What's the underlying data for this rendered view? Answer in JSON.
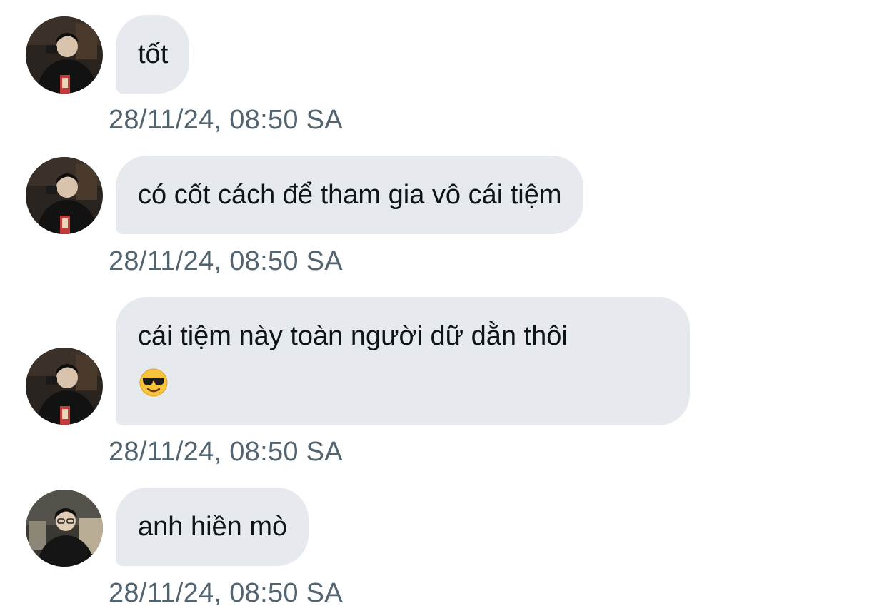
{
  "messages": [
    {
      "text": "tốt",
      "time": "28/11/24, 08:50 SA",
      "avatar": "avatar-photo-a"
    },
    {
      "text": "có cốt cách để tham gia vô cái tiệm",
      "time": "28/11/24, 08:50 SA",
      "avatar": "avatar-photo-a"
    },
    {
      "text": "cái tiệm này toàn người dữ dằn thôi",
      "emoji": "smiling-face-with-sunglasses",
      "time": "28/11/24, 08:50 SA",
      "avatar": "avatar-photo-a"
    },
    {
      "text": "anh hiền mò",
      "time": "28/11/24, 08:50 SA",
      "avatar": "avatar-photo-b"
    }
  ],
  "colors": {
    "bubble_bg": "#e6e9ee",
    "text": "#0f1419",
    "timestamp": "#536471",
    "background": "#ffffff"
  }
}
